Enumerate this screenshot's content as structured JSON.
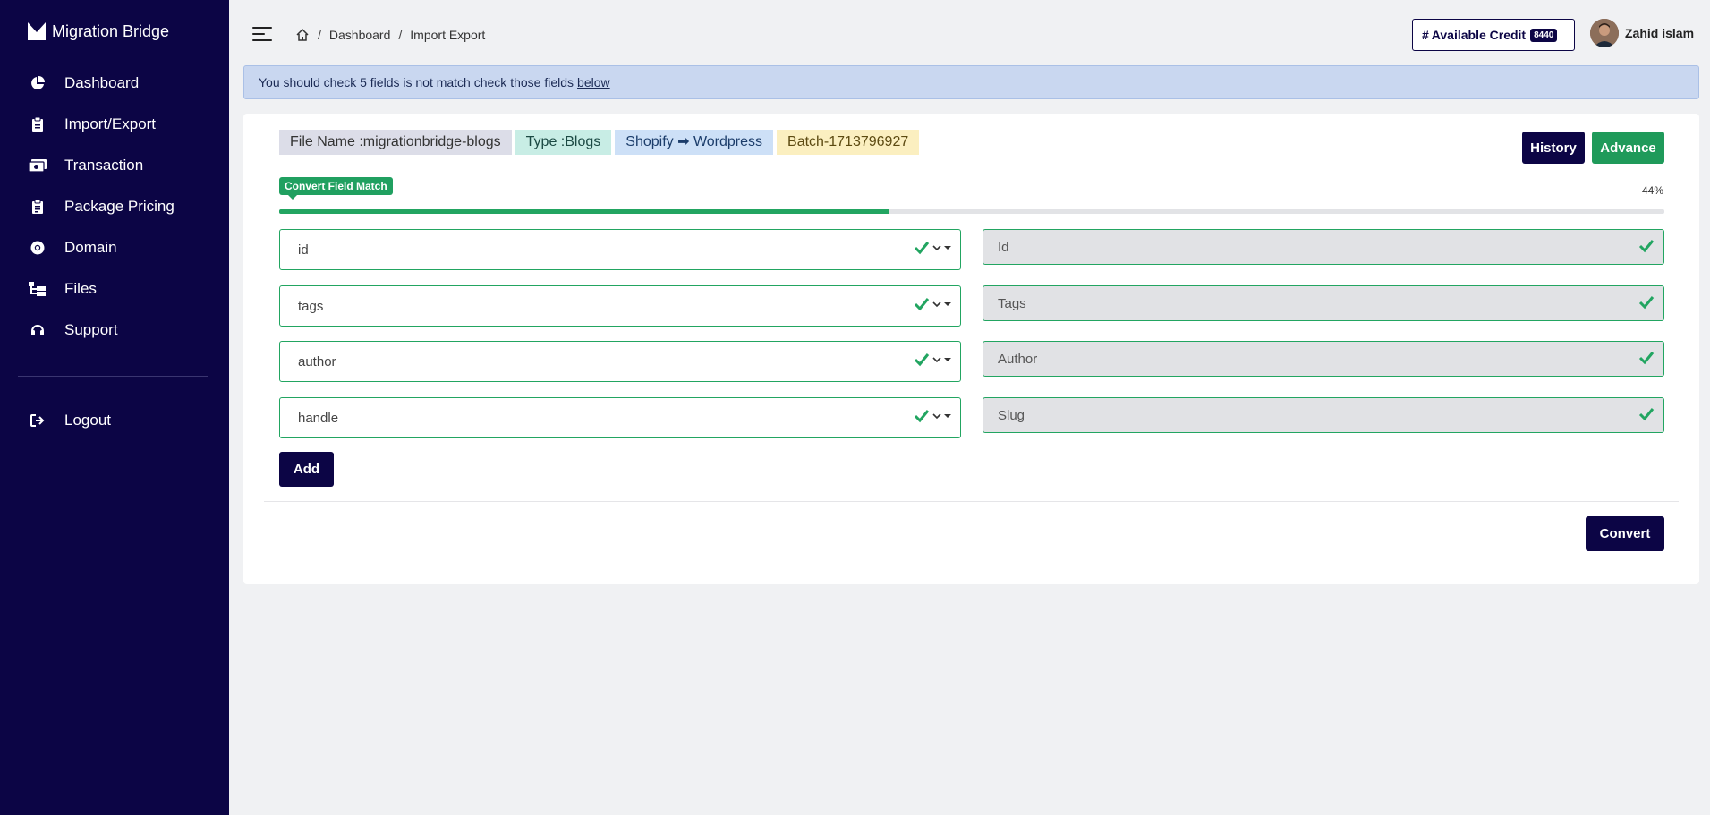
{
  "app": {
    "name": "Migration Bridge"
  },
  "sidebar": {
    "items": [
      {
        "label": "Dashboard",
        "icon": "pie-chart-icon"
      },
      {
        "label": "Import/Export",
        "icon": "clipboard-icon"
      },
      {
        "label": "Transaction",
        "icon": "money-icon"
      },
      {
        "label": "Package Pricing",
        "icon": "clipboard-list-icon"
      },
      {
        "label": "Domain",
        "icon": "chrome-icon"
      },
      {
        "label": "Files",
        "icon": "sitemap-icon"
      },
      {
        "label": "Support",
        "icon": "headset-icon"
      }
    ],
    "logout": {
      "label": "Logout",
      "icon": "logout-icon"
    }
  },
  "header": {
    "breadcrumb": [
      "Dashboard",
      "Import Export"
    ],
    "credit": {
      "label": "Available Credit",
      "value": "8440"
    },
    "user": {
      "name": "Zahid islam"
    }
  },
  "alert": {
    "text": "You should check 5 fields is not match check those fields",
    "link": "below"
  },
  "job": {
    "file_name": "File Name :migrationbridge-blogs",
    "type": "Type :Blogs",
    "source": "Shopify",
    "arrow": "➡",
    "target": "Wordpress",
    "batch": "Batch-1713796927"
  },
  "actions": {
    "history": "History",
    "advance": "Advance",
    "add": "Add",
    "convert": "Convert"
  },
  "progress": {
    "label": "Convert Field Match",
    "percent_text": "44%",
    "percent": 44
  },
  "mappings": [
    {
      "source": "id",
      "target": "Id"
    },
    {
      "source": "tags",
      "target": "Tags"
    },
    {
      "source": "author",
      "target": "Author"
    },
    {
      "source": "handle",
      "target": "Slug"
    }
  ],
  "colors": {
    "sidebar": "#0c0545",
    "success": "#22a561",
    "alert_bg": "#c9d7f0"
  }
}
